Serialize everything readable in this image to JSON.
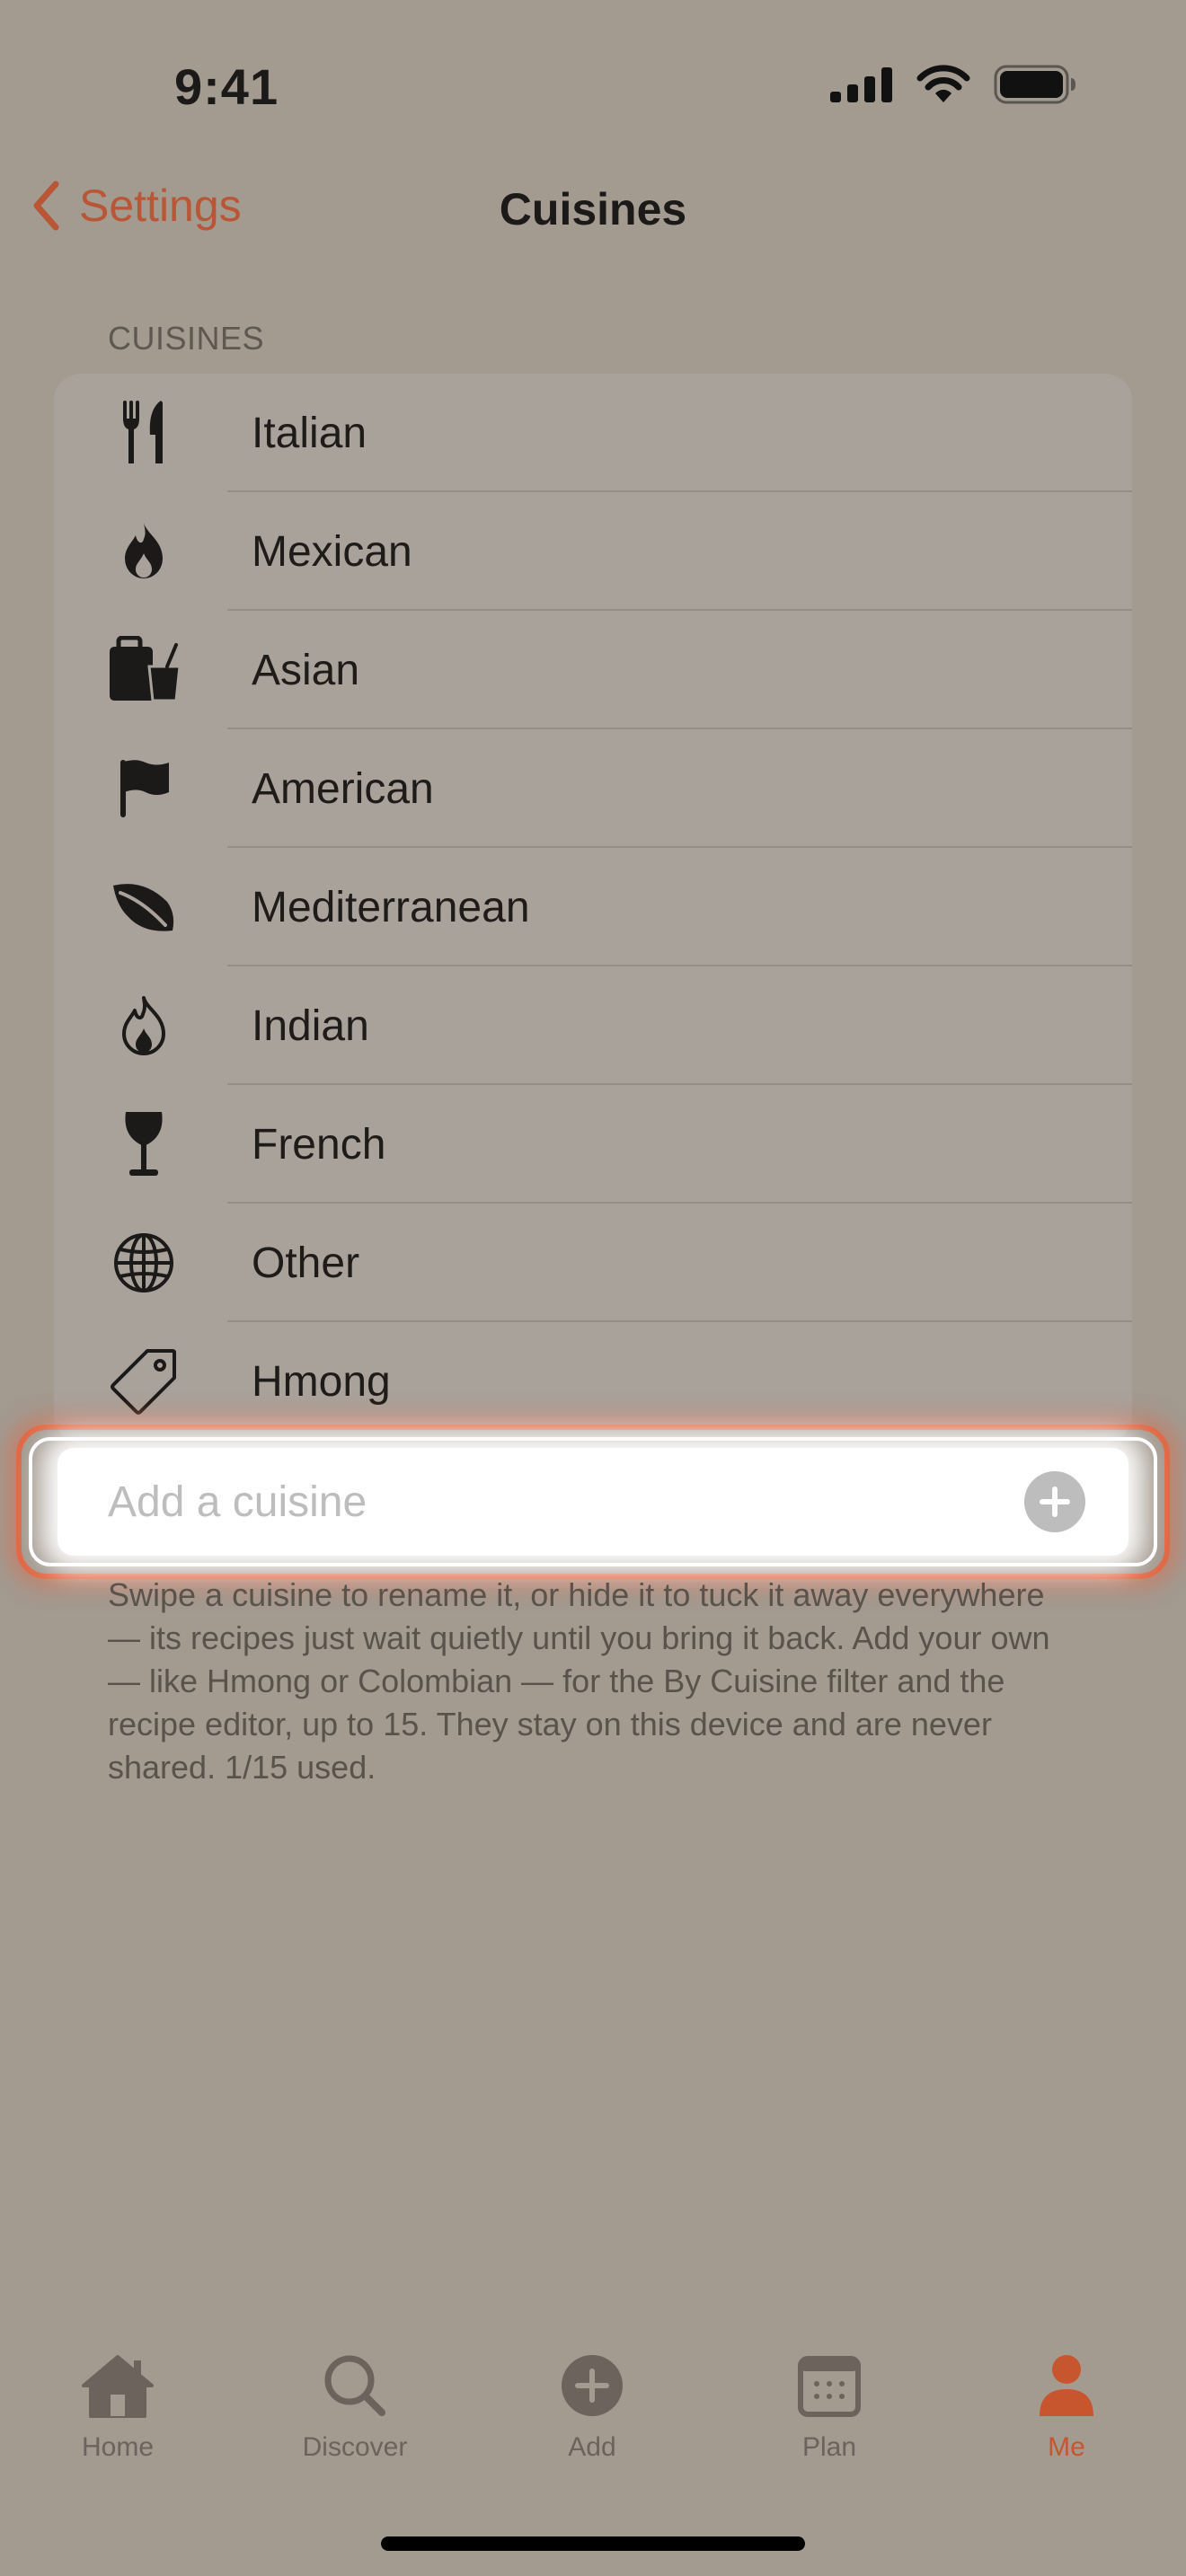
{
  "status_bar": {
    "time": "9:41"
  },
  "nav": {
    "back_label": "Settings",
    "title": "Cuisines"
  },
  "section": {
    "header": "CUISINES"
  },
  "cuisines": [
    {
      "label": "Italian",
      "icon": "fork-knife-icon"
    },
    {
      "label": "Mexican",
      "icon": "flame-icon"
    },
    {
      "label": "Asian",
      "icon": "takeout-bag-cup-icon"
    },
    {
      "label": "American",
      "icon": "flag-icon"
    },
    {
      "label": "Mediterranean",
      "icon": "leaf-icon"
    },
    {
      "label": "Indian",
      "icon": "flame-outline-icon"
    },
    {
      "label": "French",
      "icon": "wine-glass-icon"
    },
    {
      "label": "Other",
      "icon": "globe-icon"
    },
    {
      "label": "Hmong",
      "icon": "tag-icon"
    }
  ],
  "add_input": {
    "placeholder": "Add a cuisine",
    "value": ""
  },
  "footer": "Swipe a cuisine to rename it, or hide it to tuck it away everywhere — its recipes just wait quietly until you bring it back. Add your own — like Hmong or Colombian — for the By Cuisine filter and the recipe editor, up to 15. They stay on this device and are never shared. 1/15 used.",
  "tabs": [
    {
      "label": "Home",
      "icon": "house-icon",
      "active": false
    },
    {
      "label": "Discover",
      "icon": "magnifier-icon",
      "active": false
    },
    {
      "label": "Add",
      "icon": "plus-circle-icon",
      "active": false
    },
    {
      "label": "Plan",
      "icon": "calendar-icon",
      "active": false
    },
    {
      "label": "Me",
      "icon": "person-icon",
      "active": true
    }
  ],
  "colors": {
    "accent": "#c7562f",
    "background": "#a39a90",
    "card": "#a9a29b",
    "highlight_ring": "#e06845"
  }
}
